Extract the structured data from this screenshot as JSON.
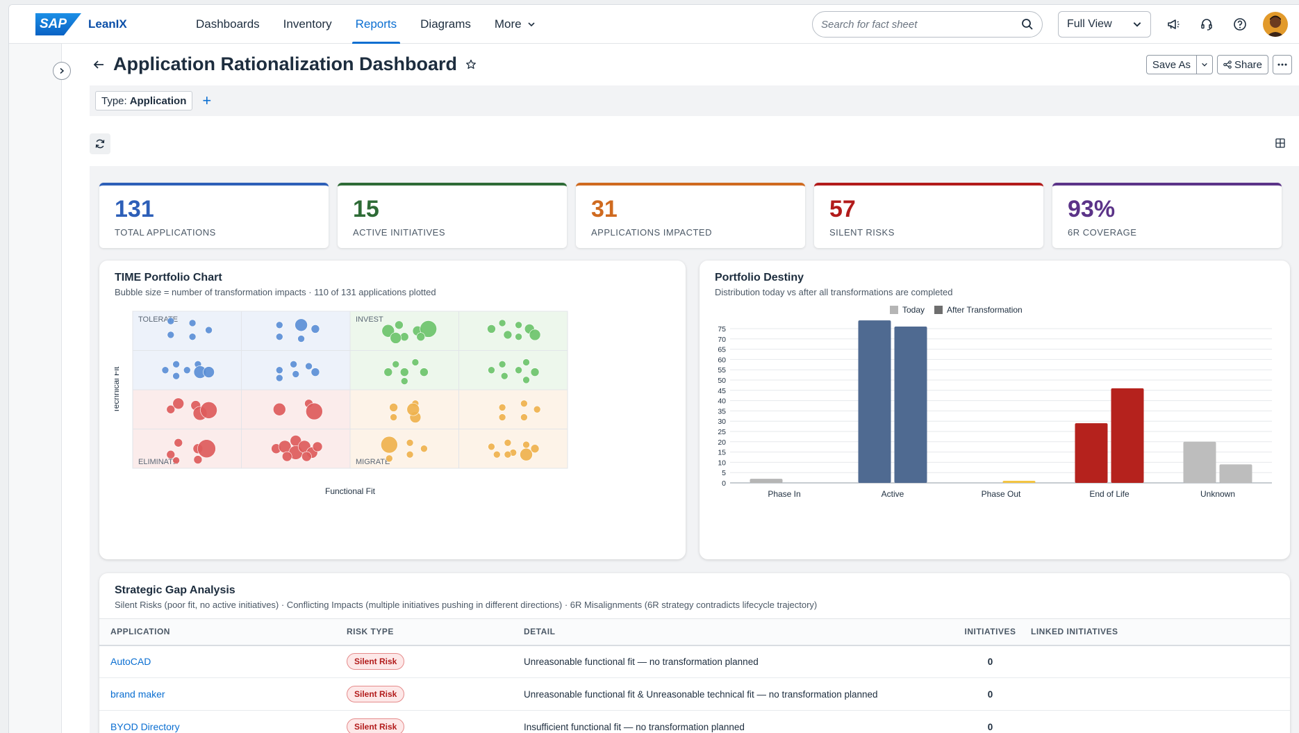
{
  "brand": {
    "logo_text": "SAP",
    "product": "LeanIX"
  },
  "nav": [
    {
      "label": "Dashboards"
    },
    {
      "label": "Inventory"
    },
    {
      "label": "Reports",
      "active": true
    },
    {
      "label": "Diagrams"
    },
    {
      "label": "More"
    }
  ],
  "search": {
    "placeholder": "Search for fact sheet"
  },
  "view_select": {
    "value": "Full View"
  },
  "icons": {
    "announcement": "megaphone-icon",
    "support": "headset-icon",
    "help": "question-icon",
    "search": "search-icon"
  },
  "page": {
    "title": "Application Rationalization Dashboard",
    "save_as": "Save As",
    "share": "Share"
  },
  "filter": {
    "type_label": "Type:",
    "type_value": "Application"
  },
  "kpis": [
    {
      "value": "131",
      "label": "TOTAL APPLICATIONS",
      "color": "#2d5fb8"
    },
    {
      "value": "15",
      "label": "ACTIVE INITIATIVES",
      "color": "#2e6b36"
    },
    {
      "value": "31",
      "label": "APPLICATIONS IMPACTED",
      "color": "#cf6a1f"
    },
    {
      "value": "57",
      "label": "SILENT RISKS",
      "color": "#b21b1b"
    },
    {
      "value": "93%",
      "label": "6R COVERAGE",
      "color": "#5b3388"
    }
  ],
  "time_chart": {
    "title": "TIME Portfolio Chart",
    "subtitle": "Bubble size = number of transformation impacts · 110 of 131 applications plotted",
    "xlabel": "Functional Fit",
    "ylabel": "Technical Fit",
    "quadrants": {
      "tolerate": "TOLERATE",
      "invest": "INVEST",
      "eliminate": "ELIMINATE",
      "migrate": "MIGRATE"
    },
    "colors": {
      "tolerate": "#5b8fd6",
      "invest": "#6cc36b",
      "eliminate": "#dd5b5b",
      "migrate": "#efb24d"
    }
  },
  "chart_data": {
    "type": "bar",
    "title": "Portfolio Destiny",
    "subtitle": "Distribution today vs after all transformations are completed",
    "categories": [
      "Phase In",
      "Active",
      "Phase Out",
      "End of Life",
      "Unknown"
    ],
    "series": [
      {
        "name": "Today",
        "values": [
          2,
          79,
          0,
          29,
          20
        ]
      },
      {
        "name": "After Transformation",
        "values": [
          0,
          76,
          1,
          46,
          9
        ]
      }
    ],
    "bar_colors": [
      [
        "#b5b5b5",
        "#b5b5b5"
      ],
      [
        "#4f6a91",
        "#4f6a91"
      ],
      [
        "#f4c542",
        "#f4c542"
      ],
      [
        "#b5221d",
        "#b5221d"
      ],
      [
        "#bdbdbd",
        "#bdbdbd"
      ]
    ],
    "legend_colors": [
      "#b5b5b5",
      "#6e6e6e"
    ],
    "ylim": [
      0,
      75
    ],
    "yticks": [
      0,
      5,
      10,
      15,
      20,
      25,
      30,
      35,
      40,
      45,
      50,
      55,
      60,
      65,
      70,
      75
    ],
    "legend": "top-center",
    "grid": true
  },
  "gap": {
    "title": "Strategic Gap Analysis",
    "subtitle": "Silent Risks (poor fit, no active initiatives) · Conflicting Impacts (multiple initiatives pushing in different directions) · 6R Misalignments (6R strategy contradicts lifecycle trajectory)",
    "columns": [
      "APPLICATION",
      "RISK TYPE",
      "DETAIL",
      "INITIATIVES",
      "LINKED INITIATIVES"
    ],
    "rows": [
      {
        "app": "AutoCAD",
        "risk": "Silent Risk",
        "detail": "Unreasonable functional fit — no transformation planned",
        "initiatives": "0",
        "linked": ""
      },
      {
        "app": "brand maker",
        "risk": "Silent Risk",
        "detail": "Unreasonable functional fit & Unreasonable technical fit — no transformation planned",
        "initiatives": "0",
        "linked": ""
      },
      {
        "app": "BYOD Directory",
        "risk": "Silent Risk",
        "detail": "Insufficient functional fit — no transformation planned",
        "initiatives": "0",
        "linked": ""
      }
    ]
  }
}
